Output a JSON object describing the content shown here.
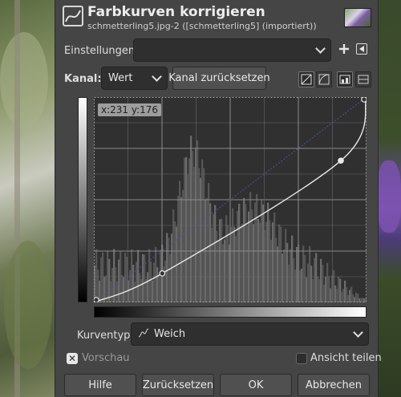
{
  "dialog": {
    "title": "Farbkurven korrigieren",
    "subtitle": "schmetterling5.jpg-2 ([schmetterling5] (importiert))",
    "icon": "curves-icon"
  },
  "settings": {
    "label": "Einstellungen:",
    "value": "",
    "add_icon": "plus-icon",
    "menu_icon": "arrow-left-icon"
  },
  "channel": {
    "label": "Kanal:",
    "value": "Wert",
    "reset_label": "Kanal zurücksetzen",
    "icons": [
      "linear-histogram-icon",
      "log-histogram-icon",
      "curve-mode-icon",
      "freehand-mode-icon"
    ]
  },
  "curve": {
    "coordinate_readout": "x:231 y:176",
    "points": [
      [
        0,
        0
      ],
      [
        64,
        36
      ],
      [
        231,
        176
      ],
      [
        255,
        255
      ]
    ]
  },
  "curve_type": {
    "label": "Kurventyp:",
    "value": "Weich",
    "icon": "smooth-curve-icon"
  },
  "preview": {
    "label": "Vorschau",
    "checked": true
  },
  "split_view": {
    "label": "Ansicht teilen",
    "checked": false
  },
  "buttons": {
    "help": "Hilfe",
    "reset": "Zurücksetzen",
    "ok": "OK",
    "cancel": "Abbrechen"
  }
}
